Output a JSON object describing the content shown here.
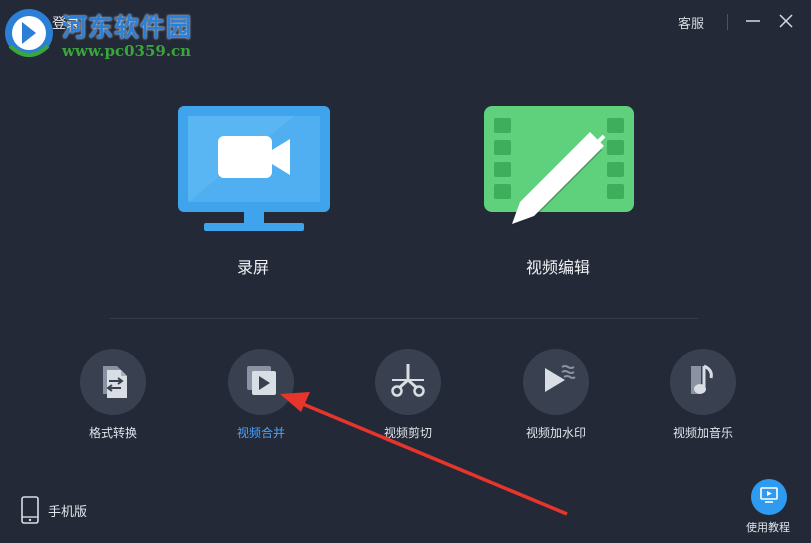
{
  "watermark": {
    "title": "河东软件园",
    "url": "www.pc0359.cn"
  },
  "topbar": {
    "login": "登录",
    "service": "客服",
    "minimize_icon": "minimize-icon",
    "close_icon": "close-icon"
  },
  "main": {
    "record": {
      "label": "录屏",
      "icon": "screen-record-icon"
    },
    "edit": {
      "label": "视频编辑",
      "icon": "video-edit-icon"
    }
  },
  "tools": [
    {
      "label": "格式转换",
      "icon": "format-convert-icon"
    },
    {
      "label": "视频合并",
      "icon": "video-merge-icon",
      "active": true
    },
    {
      "label": "视频剪切",
      "icon": "scissors-icon"
    },
    {
      "label": "视频加水印",
      "icon": "watermark-icon"
    },
    {
      "label": "视频加音乐",
      "icon": "music-note-icon"
    }
  ],
  "footer": {
    "mobile": "手机版",
    "tutorial": "使用教程"
  },
  "colors": {
    "background": "#232937",
    "accent_blue": "#2f9bf0",
    "record_blue": "#3fa4ec",
    "edit_green": "#5fd07c",
    "active_label": "#4aa3ff",
    "annotation_arrow": "#e8352c"
  }
}
